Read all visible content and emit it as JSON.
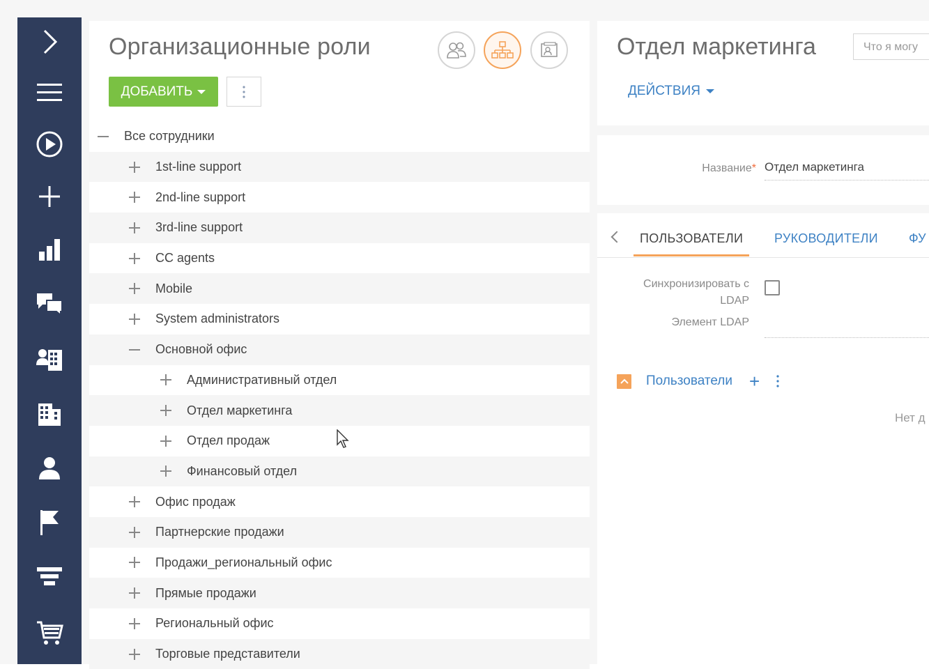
{
  "left_panel": {
    "title": "Организационные роли",
    "add_label": "ДОБАВИТЬ",
    "view_buttons": [
      "users-view-icon",
      "org-structure-icon",
      "profile-card-icon"
    ],
    "tree": [
      {
        "label": "Все сотрудники",
        "level": 0,
        "expanded": true
      },
      {
        "label": "1st-line support",
        "level": 1,
        "expanded": false
      },
      {
        "label": "2nd-line support",
        "level": 1,
        "expanded": false
      },
      {
        "label": "3rd-line support",
        "level": 1,
        "expanded": false
      },
      {
        "label": "CC agents",
        "level": 1,
        "expanded": false
      },
      {
        "label": "Mobile",
        "level": 1,
        "expanded": false
      },
      {
        "label": "System administrators",
        "level": 1,
        "expanded": false
      },
      {
        "label": "Основной офис",
        "level": 1,
        "expanded": true
      },
      {
        "label": "Административный отдел",
        "level": 2,
        "expanded": false
      },
      {
        "label": "Отдел маркетинга",
        "level": 2,
        "expanded": false
      },
      {
        "label": "Отдел продаж",
        "level": 2,
        "expanded": false
      },
      {
        "label": "Финансовый отдел",
        "level": 2,
        "expanded": false
      },
      {
        "label": "Офис продаж",
        "level": 1,
        "expanded": false
      },
      {
        "label": "Партнерские продажи",
        "level": 1,
        "expanded": false
      },
      {
        "label": "Продажи_региональный офис",
        "level": 1,
        "expanded": false
      },
      {
        "label": "Прямые продажи",
        "level": 1,
        "expanded": false
      },
      {
        "label": "Региональный офис",
        "level": 1,
        "expanded": false
      },
      {
        "label": "Торговые представители",
        "level": 1,
        "expanded": false
      }
    ]
  },
  "right_panel": {
    "title": "Отдел маркетинга",
    "search_placeholder": "Что я могу",
    "actions_label": "ДЕЙСТВИЯ",
    "name_label": "Название",
    "name_required_mark": "*",
    "name_value": "Отдел маркетинга",
    "tabs": [
      "ПОЛЬЗОВАТЕЛИ",
      "РУКОВОДИТЕЛИ",
      "ФУ"
    ],
    "sync_label_line1": "Синхронизировать с",
    "sync_label_line2": "LDAP",
    "ldap_element_label": "Элемент LDAP",
    "detail_title": "Пользователи",
    "detail_add": "+",
    "empty_text": "Нет д"
  },
  "colors": {
    "sidebar": "#2f3d5c",
    "accent_green": "#7ac143",
    "accent_orange": "#f5a35a",
    "link_blue": "#3e82c4"
  },
  "sidebar_icons": [
    "chevron-right-icon",
    "menu-icon",
    "play-icon",
    "plus-icon",
    "chart-icon",
    "chat-icon",
    "contacts-icon",
    "building-icon",
    "person-icon",
    "flag-icon",
    "funnel-icon",
    "cart-icon"
  ]
}
